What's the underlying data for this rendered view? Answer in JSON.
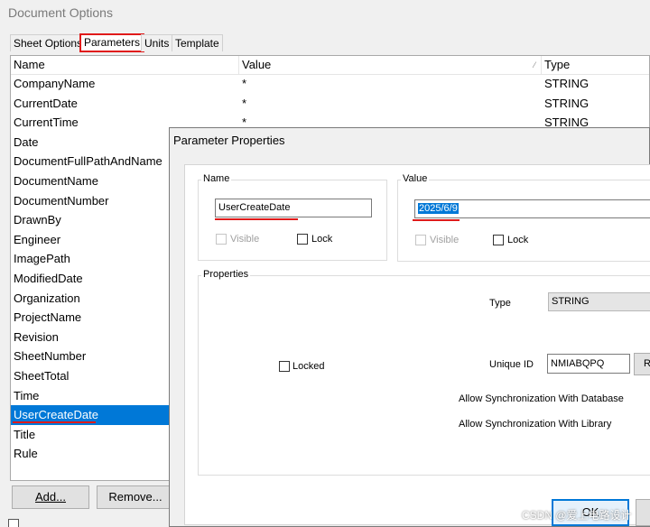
{
  "window_title": "Document Options",
  "tabs": [
    "Sheet Options",
    "Parameters",
    "Units",
    "Template"
  ],
  "columns": {
    "name": "Name",
    "value": "Value",
    "type": "Type"
  },
  "rows": [
    {
      "name": "CompanyName",
      "value": "*",
      "type": "STRING"
    },
    {
      "name": "CurrentDate",
      "value": "*",
      "type": "STRING"
    },
    {
      "name": "CurrentTime",
      "value": "*",
      "type": "STRING"
    },
    {
      "name": "Date",
      "value": "",
      "type": ""
    },
    {
      "name": "DocumentFullPathAndName",
      "value": "",
      "type": ""
    },
    {
      "name": "DocumentName",
      "value": "",
      "type": ""
    },
    {
      "name": "DocumentNumber",
      "value": "",
      "type": ""
    },
    {
      "name": "DrawnBy",
      "value": "",
      "type": ""
    },
    {
      "name": "Engineer",
      "value": "",
      "type": ""
    },
    {
      "name": "ImagePath",
      "value": "",
      "type": ""
    },
    {
      "name": "ModifiedDate",
      "value": "",
      "type": ""
    },
    {
      "name": "Organization",
      "value": "",
      "type": ""
    },
    {
      "name": "ProjectName",
      "value": "",
      "type": ""
    },
    {
      "name": "Revision",
      "value": "",
      "type": ""
    },
    {
      "name": "SheetNumber",
      "value": "",
      "type": ""
    },
    {
      "name": "SheetTotal",
      "value": "",
      "type": ""
    },
    {
      "name": "Time",
      "value": "",
      "type": ""
    },
    {
      "name": "UserCreateDate",
      "value": "",
      "type": ""
    },
    {
      "name": "Title",
      "value": "",
      "type": ""
    },
    {
      "name": "Rule",
      "value": "",
      "type": ""
    }
  ],
  "buttons": {
    "add": "Add...",
    "remove": "Remove..."
  },
  "dialog": {
    "title": "Parameter Properties",
    "name_group": "Name",
    "name_value": "UserCreateDate",
    "value_group": "Value",
    "value_value": "2025/6/9",
    "visible_label": "Visible",
    "lock_label": "Lock",
    "properties_group": "Properties",
    "type_label": "Type",
    "type_value": "STRING",
    "locked_label": "Locked",
    "unique_id_label": "Unique ID",
    "unique_id_value": "NMIABQPQ",
    "reset_label": "R",
    "sync_db": "Allow Synchronization With Database",
    "sync_lib": "Allow Synchronization With Library",
    "ok": "OK"
  },
  "watermark": "CSDN @爱上电路设计",
  "colors": {
    "selection": "#0078d7",
    "annotation": "#e01a1a"
  }
}
